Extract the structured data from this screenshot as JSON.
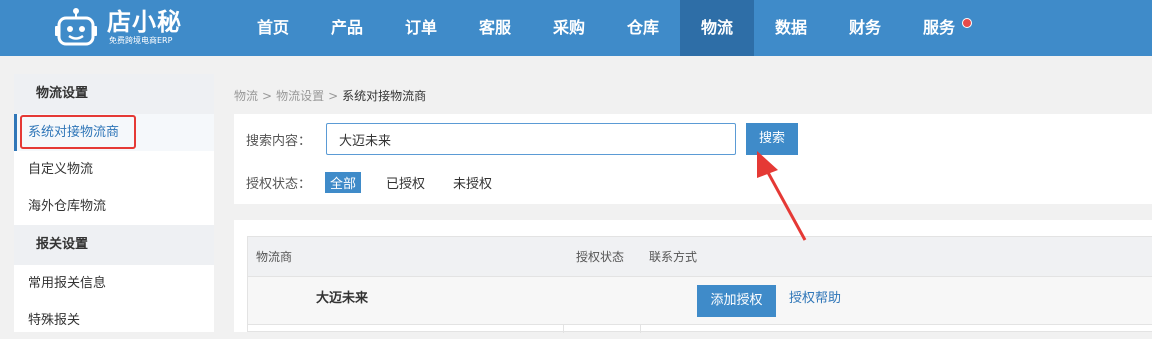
{
  "app": {
    "logo_title": "店小秘",
    "logo_subtitle": "免费跨境电商ERP"
  },
  "nav": {
    "items": [
      "首页",
      "产品",
      "订单",
      "客服",
      "采购",
      "仓库",
      "物流",
      "数据",
      "财务",
      "服务"
    ],
    "active": "物流"
  },
  "sidebar": {
    "group1": "物流设置",
    "group1_items": [
      "系统对接物流商",
      "自定义物流",
      "海外仓库物流"
    ],
    "group2": "报关设置",
    "group2_items": [
      "常用报关信息",
      "特殊报关"
    ]
  },
  "breadcrumb": {
    "items": [
      "物流",
      "物流设置",
      "系统对接物流商"
    ],
    "sep": ">"
  },
  "search": {
    "label": "搜索内容：",
    "value": "大迈未来",
    "button": "搜索",
    "auth_label": "授权状态：",
    "filters": [
      "全部",
      "已授权",
      "未授权"
    ],
    "active_filter": "全部"
  },
  "table": {
    "headers": [
      "物流商",
      "授权状态",
      "联系方式"
    ],
    "rows": [
      {
        "name": "大迈未来",
        "action": "添加授权",
        "help": "授权帮助"
      }
    ]
  },
  "colors": {
    "brand": "#3f8bc9",
    "nav_active": "#2e6ea7",
    "highlight": "#e53935"
  }
}
